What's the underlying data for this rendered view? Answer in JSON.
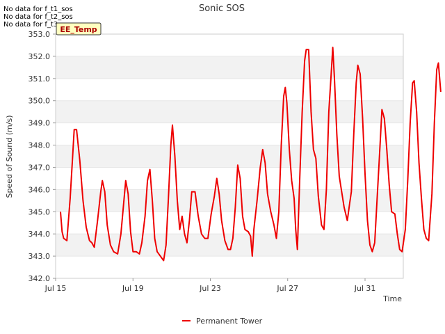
{
  "no_data_messages": [
    "No data for f_t1_sos",
    "No data for f_t2_sos",
    "No data for f_t3_sos"
  ],
  "chart_data": {
    "type": "line",
    "title": "Sonic SOS",
    "xlabel": "Time",
    "ylabel": "Speed of Sound (m/s)",
    "ylim": [
      342.0,
      353.0
    ],
    "y_ticks": [
      "342.0",
      "343.0",
      "344.0",
      "345.0",
      "346.0",
      "347.0",
      "348.0",
      "349.0",
      "350.0",
      "351.0",
      "352.0",
      "353.0"
    ],
    "xlim": [
      "2024-07-15",
      "2024-08-02"
    ],
    "x_ticks": [
      {
        "date": "2024-07-15",
        "label": "Jul 15"
      },
      {
        "date": "2024-07-19",
        "label": "Jul 19"
      },
      {
        "date": "2024-07-23",
        "label": "Jul 23"
      },
      {
        "date": "2024-07-27",
        "label": "Jul 27"
      },
      {
        "date": "2024-07-31",
        "label": "Jul 31"
      }
    ],
    "grid": true,
    "band_color": "#f2f2f2",
    "annotation": "EE_Temp",
    "legend_position": "bottom-center",
    "series": [
      {
        "name": "Permanent Tower",
        "color": "#ee0000",
        "points": [
          [
            "2024-07-15T06:00",
            345.0
          ],
          [
            "2024-07-15T08:00",
            344.1
          ],
          [
            "2024-07-15T10:00",
            343.8
          ],
          [
            "2024-07-15T14:00",
            343.7
          ],
          [
            "2024-07-15T18:00",
            345.6
          ],
          [
            "2024-07-15T21:00",
            347.4
          ],
          [
            "2024-07-15T23:00",
            348.7
          ],
          [
            "2024-07-16T02:00",
            348.7
          ],
          [
            "2024-07-16T06:00",
            347.3
          ],
          [
            "2024-07-16T10:00",
            345.5
          ],
          [
            "2024-07-16T14:00",
            344.3
          ],
          [
            "2024-07-16T18:00",
            343.7
          ],
          [
            "2024-07-16T21:00",
            343.6
          ],
          [
            "2024-07-17T00:00",
            343.4
          ],
          [
            "2024-07-17T04:00",
            344.6
          ],
          [
            "2024-07-17T08:00",
            345.9
          ],
          [
            "2024-07-17T10:00",
            346.4
          ],
          [
            "2024-07-17T13:00",
            345.9
          ],
          [
            "2024-07-17T16:00",
            344.4
          ],
          [
            "2024-07-17T20:00",
            343.5
          ],
          [
            "2024-07-18T00:00",
            343.2
          ],
          [
            "2024-07-18T05:00",
            343.1
          ],
          [
            "2024-07-18T09:00",
            344.0
          ],
          [
            "2024-07-18T13:00",
            345.6
          ],
          [
            "2024-07-18T15:00",
            346.4
          ],
          [
            "2024-07-18T18:00",
            345.8
          ],
          [
            "2024-07-18T21:00",
            344.1
          ],
          [
            "2024-07-19T00:00",
            343.2
          ],
          [
            "2024-07-19T04:00",
            343.2
          ],
          [
            "2024-07-19T08:00",
            343.1
          ],
          [
            "2024-07-19T11:00",
            343.6
          ],
          [
            "2024-07-19T15:00",
            344.8
          ],
          [
            "2024-07-19T18:00",
            346.4
          ],
          [
            "2024-07-19T21:00",
            346.9
          ],
          [
            "2024-07-20T00:00",
            345.5
          ],
          [
            "2024-07-20T03:00",
            343.8
          ],
          [
            "2024-07-20T06:00",
            343.2
          ],
          [
            "2024-07-20T10:00",
            343.0
          ],
          [
            "2024-07-20T14:00",
            342.8
          ],
          [
            "2024-07-20T17:00",
            343.5
          ],
          [
            "2024-07-20T20:00",
            345.6
          ],
          [
            "2024-07-20T23:00",
            348.0
          ],
          [
            "2024-07-21T01:00",
            348.9
          ],
          [
            "2024-07-21T04:00",
            347.5
          ],
          [
            "2024-07-21T07:00",
            345.5
          ],
          [
            "2024-07-21T10:00",
            344.2
          ],
          [
            "2024-07-21T13:00",
            344.8
          ],
          [
            "2024-07-21T16:00",
            344.0
          ],
          [
            "2024-07-21T19:00",
            343.6
          ],
          [
            "2024-07-21T22:00",
            344.6
          ],
          [
            "2024-07-22T01:00",
            345.9
          ],
          [
            "2024-07-22T05:00",
            345.9
          ],
          [
            "2024-07-22T09:00",
            344.8
          ],
          [
            "2024-07-22T13:00",
            344.0
          ],
          [
            "2024-07-22T17:00",
            343.8
          ],
          [
            "2024-07-22T21:00",
            343.8
          ],
          [
            "2024-07-23T01:00",
            344.9
          ],
          [
            "2024-07-23T05:00",
            345.7
          ],
          [
            "2024-07-23T08:00",
            346.5
          ],
          [
            "2024-07-23T11:00",
            345.8
          ],
          [
            "2024-07-23T14:00",
            344.6
          ],
          [
            "2024-07-23T18:00",
            343.7
          ],
          [
            "2024-07-23T22:00",
            343.3
          ],
          [
            "2024-07-24T01:00",
            343.3
          ],
          [
            "2024-07-24T04:00",
            343.8
          ],
          [
            "2024-07-24T07:00",
            345.2
          ],
          [
            "2024-07-24T10:00",
            347.1
          ],
          [
            "2024-07-24T13:00",
            346.5
          ],
          [
            "2024-07-24T16:00",
            344.8
          ],
          [
            "2024-07-24T19:00",
            344.2
          ],
          [
            "2024-07-24T23:00",
            344.1
          ],
          [
            "2024-07-25T02:00",
            343.9
          ],
          [
            "2024-07-25T04:00",
            343.0
          ],
          [
            "2024-07-25T06:00",
            344.2
          ],
          [
            "2024-07-25T10:00",
            345.5
          ],
          [
            "2024-07-25T14:00",
            347.0
          ],
          [
            "2024-07-25T17:00",
            347.8
          ],
          [
            "2024-07-25T20:00",
            347.2
          ],
          [
            "2024-07-25T23:00",
            345.8
          ],
          [
            "2024-07-26T03:00",
            345.0
          ],
          [
            "2024-07-26T07:00",
            344.4
          ],
          [
            "2024-07-26T10:00",
            343.8
          ],
          [
            "2024-07-26T13:00",
            345.0
          ],
          [
            "2024-07-26T16:00",
            348.0
          ],
          [
            "2024-07-26T19:00",
            350.2
          ],
          [
            "2024-07-26T21:00",
            350.6
          ],
          [
            "2024-07-26T23:00",
            349.9
          ],
          [
            "2024-07-27T02:00",
            347.8
          ],
          [
            "2024-07-27T05:00",
            346.4
          ],
          [
            "2024-07-27T08:00",
            345.6
          ],
          [
            "2024-07-27T10:00",
            344.2
          ],
          [
            "2024-07-27T12:00",
            343.3
          ],
          [
            "2024-07-27T15:00",
            346.5
          ],
          [
            "2024-07-27T18:00",
            349.5
          ],
          [
            "2024-07-27T21:00",
            351.8
          ],
          [
            "2024-07-27T23:00",
            352.3
          ],
          [
            "2024-07-28T02:00",
            352.3
          ],
          [
            "2024-07-28T05:00",
            349.5
          ],
          [
            "2024-07-28T08:00",
            347.8
          ],
          [
            "2024-07-28T11:00",
            347.4
          ],
          [
            "2024-07-28T14:00",
            345.7
          ],
          [
            "2024-07-28T18:00",
            344.4
          ],
          [
            "2024-07-28T21:00",
            344.2
          ],
          [
            "2024-07-29T00:00",
            346.0
          ],
          [
            "2024-07-29T03:00",
            349.5
          ],
          [
            "2024-07-29T06:00",
            351.2
          ],
          [
            "2024-07-29T08:00",
            352.4
          ],
          [
            "2024-07-29T10:00",
            351.0
          ],
          [
            "2024-07-29T13:00",
            348.5
          ],
          [
            "2024-07-29T16:00",
            346.6
          ],
          [
            "2024-07-29T19:00",
            345.9
          ],
          [
            "2024-07-29T22:00",
            345.2
          ],
          [
            "2024-07-30T02:00",
            344.6
          ],
          [
            "2024-07-30T05:00",
            345.4
          ],
          [
            "2024-07-30T07:00",
            345.9
          ],
          [
            "2024-07-30T10:00",
            348.5
          ],
          [
            "2024-07-30T13:00",
            350.8
          ],
          [
            "2024-07-30T15:00",
            351.6
          ],
          [
            "2024-07-30T18:00",
            351.2
          ],
          [
            "2024-07-30T21:00",
            349.2
          ],
          [
            "2024-07-31T00:00",
            346.7
          ],
          [
            "2024-07-31T03:00",
            344.6
          ],
          [
            "2024-07-31T06:00",
            343.5
          ],
          [
            "2024-07-31T09:00",
            343.2
          ],
          [
            "2024-07-31T12:00",
            343.6
          ],
          [
            "2024-07-31T15:00",
            345.6
          ],
          [
            "2024-07-31T18:00",
            347.6
          ],
          [
            "2024-07-31T21:00",
            349.6
          ],
          [
            "2024-08-01T00:00",
            349.2
          ],
          [
            "2024-08-01T03:00",
            347.8
          ],
          [
            "2024-08-01T06:00",
            346.2
          ],
          [
            "2024-08-01T09:00",
            345.0
          ],
          [
            "2024-08-01T13:00",
            344.9
          ],
          [
            "2024-08-01T16:00",
            344.0
          ],
          [
            "2024-08-01T19:00",
            343.3
          ],
          [
            "2024-08-01T22:00",
            343.2
          ],
          [
            "2024-08-02T02:00",
            344.2
          ],
          [
            "2024-08-02T05:00",
            346.4
          ],
          [
            "2024-08-02T08:00",
            349.0
          ],
          [
            "2024-08-02T11:00",
            350.8
          ],
          [
            "2024-08-02T13:00",
            350.9
          ],
          [
            "2024-08-02T16:00",
            349.5
          ],
          [
            "2024-08-02T19:00",
            347.2
          ],
          [
            "2024-08-02T22:00",
            345.6
          ],
          [
            "2024-08-03T01:00",
            344.2
          ],
          [
            "2024-08-03T04:00",
            343.8
          ],
          [
            "2024-08-03T07:00",
            343.7
          ],
          [
            "2024-08-03T11:00",
            345.8
          ],
          [
            "2024-08-03T14:00",
            349.0
          ],
          [
            "2024-08-03T17:00",
            351.4
          ],
          [
            "2024-08-03T19:00",
            351.7
          ],
          [
            "2024-08-03T22:00",
            350.4
          ]
        ]
      }
    ]
  }
}
